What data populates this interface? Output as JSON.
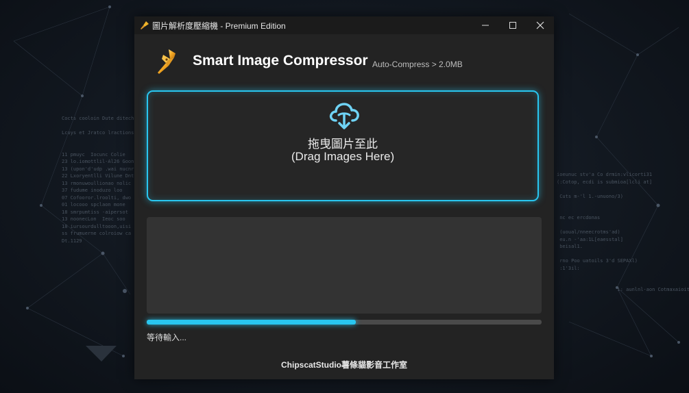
{
  "window": {
    "title": "圖片解析度壓縮機 - Premium Edition",
    "controls": {
      "minimize": "─",
      "maximize": "☐",
      "close": "✕"
    }
  },
  "header": {
    "title": "Smart Image Compressor",
    "subtitle": "Auto-Compress > 2.0MB",
    "logo_icon": "pen-nib-icon"
  },
  "dropzone": {
    "icon": "cloud-download-icon",
    "text_zh": "拖曳圖片至此",
    "text_en": "(Drag Images Here)"
  },
  "log_panel": {
    "lines": []
  },
  "progress": {
    "value": 0.53
  },
  "status": {
    "text": "等待輸入..."
  },
  "footer": {
    "text": "ChipscatStudio薯條貓影音工作室"
  },
  "colors": {
    "accent": "#29c6f0",
    "window_bg": "#232323",
    "titlebar_bg": "#1b1b1b",
    "logo": "#f0b429"
  }
}
